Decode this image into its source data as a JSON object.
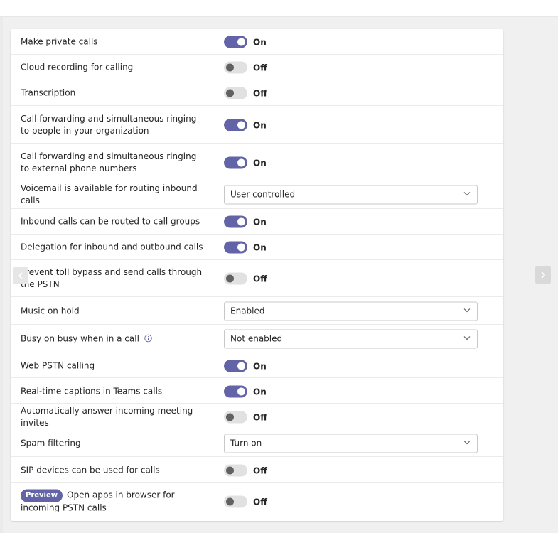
{
  "settings": [
    {
      "label": "Make private calls",
      "type": "toggle",
      "state": "on",
      "value": "On"
    },
    {
      "label": "Cloud recording for calling",
      "type": "toggle",
      "state": "off",
      "value": "Off"
    },
    {
      "label": "Transcription",
      "type": "toggle",
      "state": "off",
      "value": "Off"
    },
    {
      "label": "Call forwarding and simultaneous ringing to people in your organization",
      "type": "toggle",
      "state": "on",
      "value": "On"
    },
    {
      "label": "Call forwarding and simultaneous ringing to external phone numbers",
      "type": "toggle",
      "state": "on",
      "value": "On"
    },
    {
      "label": "Voicemail is available for routing inbound calls",
      "type": "dropdown",
      "value": "User controlled"
    },
    {
      "label": "Inbound calls can be routed to call groups",
      "type": "toggle",
      "state": "on",
      "value": "On"
    },
    {
      "label": "Delegation for inbound and outbound calls",
      "type": "toggle",
      "state": "on",
      "value": "On"
    },
    {
      "label": "Prevent toll bypass and send calls through the PSTN",
      "type": "toggle",
      "state": "off",
      "value": "Off"
    },
    {
      "label": "Music on hold",
      "type": "dropdown",
      "value": "Enabled"
    },
    {
      "label": "Busy on busy when in a call",
      "type": "dropdown",
      "value": "Not enabled",
      "info_icon": "info-circle-icon"
    },
    {
      "label": "Web PSTN calling",
      "type": "toggle",
      "state": "on",
      "value": "On"
    },
    {
      "label": "Real-time captions in Teams calls",
      "type": "toggle",
      "state": "on",
      "value": "On"
    },
    {
      "label": "Automatically answer incoming meeting invites",
      "type": "toggle",
      "state": "off",
      "value": "Off"
    },
    {
      "label": "Spam filtering",
      "type": "dropdown",
      "value": "Turn on"
    },
    {
      "label": "SIP devices can be used for calls",
      "type": "toggle",
      "state": "off",
      "value": "Off"
    },
    {
      "label": "Open apps in browser for incoming PSTN calls",
      "type": "toggle",
      "state": "off",
      "value": "Off",
      "badge": "Preview"
    }
  ],
  "colors": {
    "accent": "#6264a7",
    "toggle_off_track": "#e1e1e1",
    "toggle_off_knob": "#616161"
  },
  "icons": {
    "dropdown": "chevron-down-icon",
    "nav_left": "chevron-left-icon",
    "nav_right": "chevron-right-icon"
  }
}
